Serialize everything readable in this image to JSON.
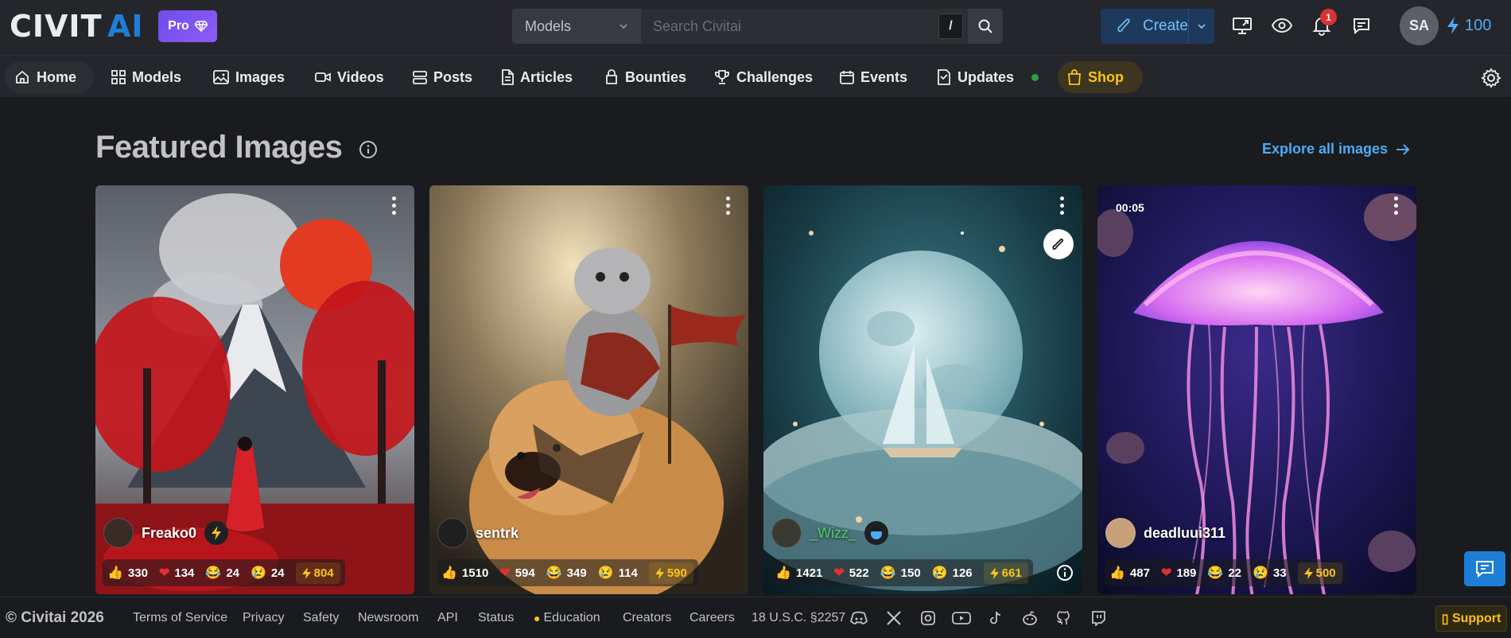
{
  "app": {
    "logo_text": "CIVITAI",
    "pro_label": "Pro"
  },
  "search": {
    "category": "Models",
    "placeholder": "Search Civitai",
    "shortcut": "/"
  },
  "header": {
    "create_label": "Create",
    "notification_count": "1",
    "avatar_initials": "SA",
    "buzz_amount": "100"
  },
  "nav": {
    "items": [
      {
        "label": "Home",
        "icon": "home-icon"
      },
      {
        "label": "Models",
        "icon": "grid-icon"
      },
      {
        "label": "Images",
        "icon": "image-icon"
      },
      {
        "label": "Videos",
        "icon": "video-icon"
      },
      {
        "label": "Posts",
        "icon": "posts-icon"
      },
      {
        "label": "Articles",
        "icon": "article-icon"
      },
      {
        "label": "Bounties",
        "icon": "bounty-icon"
      },
      {
        "label": "Challenges",
        "icon": "trophy-icon"
      },
      {
        "label": "Events",
        "icon": "calendar-icon"
      },
      {
        "label": "Updates",
        "icon": "updates-icon"
      },
      {
        "label": "Shop",
        "icon": "shopping-bag-icon"
      }
    ]
  },
  "main": {
    "title": "Featured Images",
    "explore_label": "Explore all images"
  },
  "cards": [
    {
      "user": "Freako0",
      "like": "330",
      "heart": "134",
      "laugh": "24",
      "cry": "24",
      "buzz": "804"
    },
    {
      "user": "sentrk",
      "like": "1510",
      "heart": "594",
      "laugh": "349",
      "cry": "114",
      "buzz": "590"
    },
    {
      "user": "_Wizz_",
      "like": "1421",
      "heart": "522",
      "laugh": "150",
      "cry": "126",
      "buzz": "661"
    },
    {
      "user": "deadluui311",
      "duration": "00:05",
      "like": "487",
      "heart": "189",
      "laugh": "22",
      "cry": "33",
      "buzz": "500"
    }
  ],
  "footer": {
    "copyright": "© Civitai 2026",
    "links": [
      "Terms of Service",
      "Privacy",
      "Safety",
      "Newsroom",
      "API",
      "Status",
      "Education",
      "Creators",
      "Careers",
      "18 U.S.C. §2257"
    ],
    "support_label": "Support"
  },
  "colors": {
    "background": "#1a1b1e",
    "header": "#25262b",
    "accent_blue": "#4dabf7",
    "pro_purple": "#7b55f0",
    "buzz_yellow": "#fcc419"
  }
}
